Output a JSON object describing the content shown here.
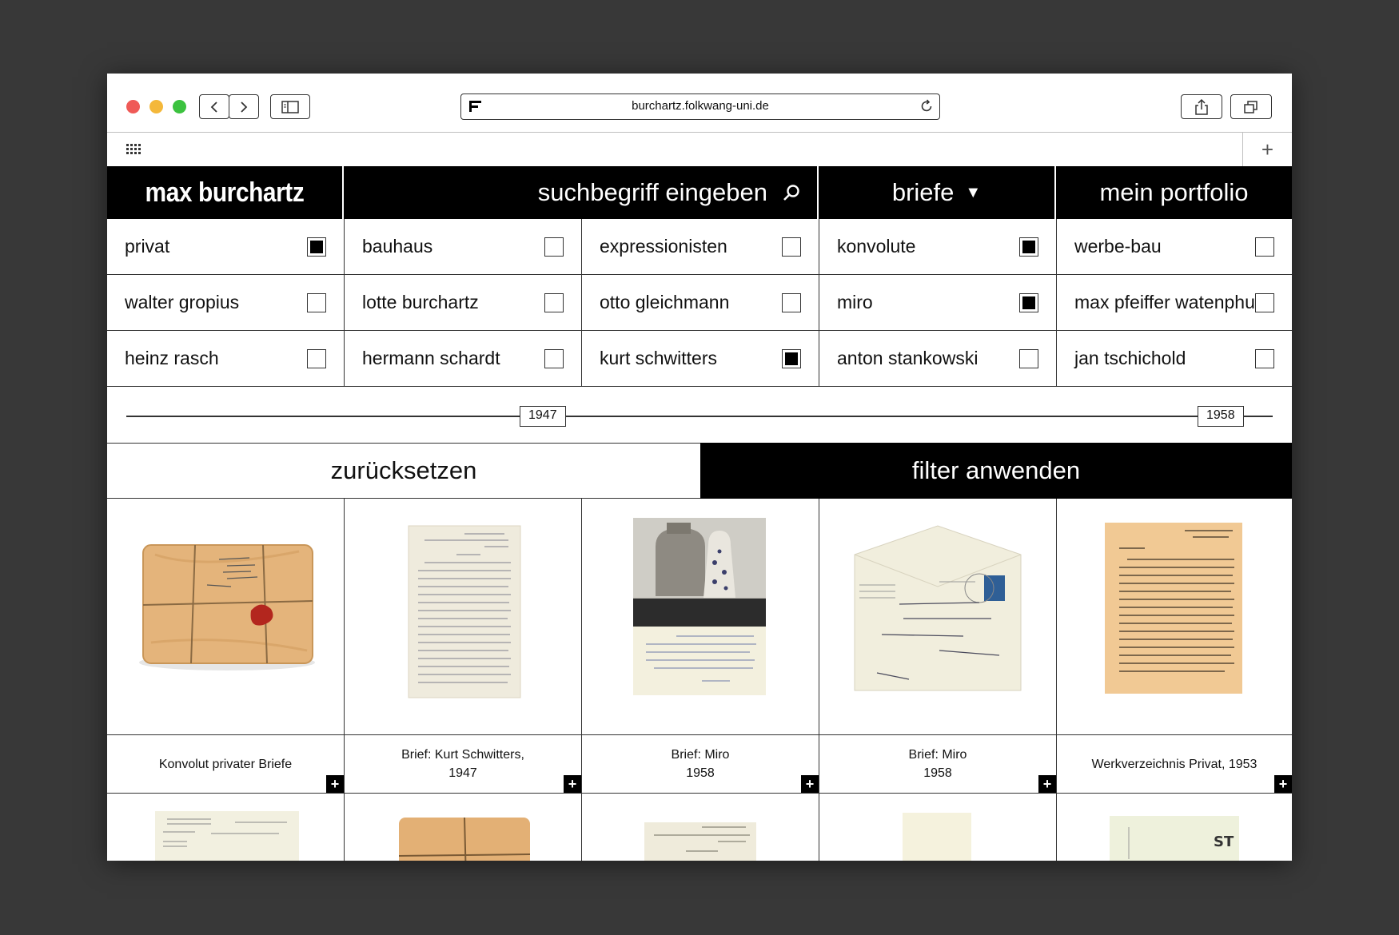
{
  "browser": {
    "url": "burchartz.folkwang-uni.de"
  },
  "nav": {
    "logo": "max burchartz",
    "search_placeholder": "suchbegriff eingeben",
    "category": "briefe",
    "portfolio": "mein portfolio"
  },
  "filters": [
    [
      {
        "label": "privat",
        "checked": true
      },
      {
        "label": "bauhaus",
        "checked": false
      },
      {
        "label": "expressionisten",
        "checked": false
      },
      {
        "label": "konvolute",
        "checked": true
      },
      {
        "label": "werbe-bau",
        "checked": false
      }
    ],
    [
      {
        "label": "walter gropius",
        "checked": false
      },
      {
        "label": "lotte burchartz",
        "checked": false
      },
      {
        "label": "otto gleichmann",
        "checked": false
      },
      {
        "label": "miro",
        "checked": true
      },
      {
        "label": "max pfeiffer watenphul",
        "checked": false
      }
    ],
    [
      {
        "label": "heinz rasch",
        "checked": false
      },
      {
        "label": "hermann schardt",
        "checked": false
      },
      {
        "label": "kurt schwitters",
        "checked": true
      },
      {
        "label": "anton stankowski",
        "checked": false
      },
      {
        "label": "jan tschichold",
        "checked": false
      }
    ]
  ],
  "range": {
    "from": "1947",
    "to": "1958"
  },
  "actions": {
    "reset": "zurücksetzen",
    "apply": "filter anwenden"
  },
  "results": [
    {
      "line1": "Konvolut privater Briefe",
      "line2": ""
    },
    {
      "line1": "Brief: Kurt Schwitters,",
      "line2": "1947"
    },
    {
      "line1": "Brief: Miro",
      "line2": "1958"
    },
    {
      "line1": "Brief: Miro",
      "line2": "1958"
    },
    {
      "line1": "Werkverzeichnis Privat, 1953",
      "line2": ""
    }
  ],
  "add_label": "+",
  "new_tab_label": "+",
  "colors": {
    "accent": "#000000",
    "background": "#ffffff",
    "desktop": "#383838"
  }
}
